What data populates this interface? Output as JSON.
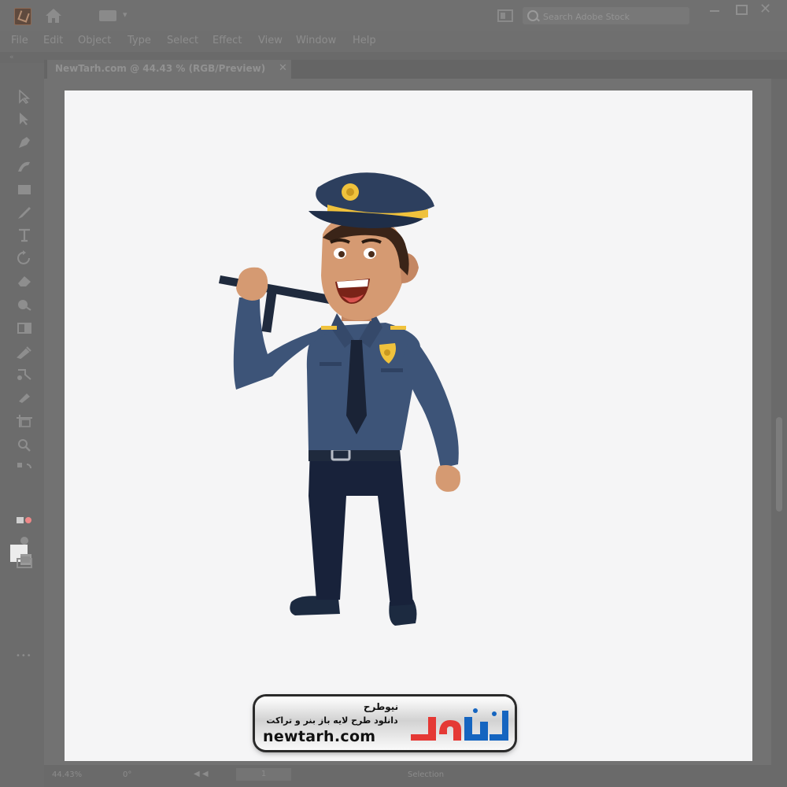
{
  "app": {
    "logo_icon": "illustrator-logo-icon",
    "home_icon": "home-icon",
    "workspace_icon": "workspace-switcher-icon",
    "arrange_icon": "arrange-documents-icon",
    "search_placeholder": "Search Adobe Stock",
    "window_controls": {
      "minimize": "—",
      "maximize": "",
      "close": "✕"
    }
  },
  "menu": {
    "items": [
      "File",
      "Edit",
      "Object",
      "Type",
      "Select",
      "Effect",
      "View",
      "Window",
      "Help"
    ]
  },
  "document": {
    "tab_label": "NewTarh.com @ 44.43 % (RGB/Preview)",
    "close": "✕"
  },
  "toolbar": {
    "tools": [
      "selection-tool-icon",
      "direct-selection-tool-icon",
      "pen-tool-icon",
      "curvature-tool-icon",
      "rectangle-tool-icon",
      "paintbrush-tool-icon",
      "type-tool-icon",
      "rotate-tool-icon",
      "eraser-tool-icon",
      "shape-builder-tool-icon",
      "gradient-tool-icon",
      "eyedropper-tool-icon",
      "blend-tool-icon",
      "symbol-sprayer-tool-icon",
      "artboard-tool-icon",
      "zoom-tool-icon"
    ],
    "more": "•••"
  },
  "illustration": {
    "subject": "police-officer-cartoon",
    "colors": {
      "uniform": "#3d5478",
      "pants": "#18223a",
      "skin": "#d59a72",
      "hat": "#2d3f5e",
      "badge": "#f0c23c",
      "tie": "#1a2336",
      "baton": "#1f2a3d"
    }
  },
  "watermark": {
    "title": "نیوطرح",
    "subtitle": "دانلود طرح لایه باز بنر و تراکت",
    "url": "newtarh.com",
    "logo_text": "نیوطرح",
    "logo_colors": {
      "primary": "#1565c0",
      "accent": "#e53935"
    }
  },
  "statusbar": {
    "zoom": "44.43%",
    "rotation": "0°",
    "nav": "◀ ◀",
    "page": "1",
    "tool": "Selection"
  }
}
